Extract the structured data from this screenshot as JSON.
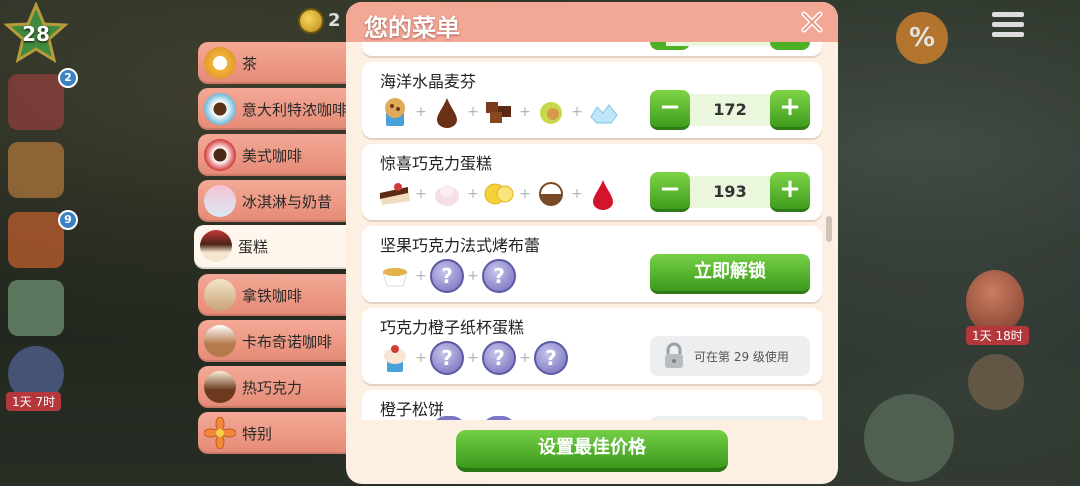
{
  "hud": {
    "level": "28",
    "coins_partial": "2",
    "notif_tasks": "2",
    "notif_gifts": "9",
    "timer_left": "1天 7时",
    "timer_right": "1天 18时",
    "discount_symbol": "%"
  },
  "tabs": [
    {
      "label": "茶",
      "icon": "tea-cup-icon"
    },
    {
      "label": "意大利特浓咖啡",
      "icon": "espresso-icon"
    },
    {
      "label": "美式咖啡",
      "icon": "americano-icon"
    },
    {
      "label": "冰淇淋与奶昔",
      "icon": "milkshake-icon"
    },
    {
      "label": "蛋糕",
      "icon": "cake-icon",
      "active": true
    },
    {
      "label": "拿铁咖啡",
      "icon": "latte-icon"
    },
    {
      "label": "卡布奇诺咖啡",
      "icon": "cappuccino-icon"
    },
    {
      "label": "热巧克力",
      "icon": "hot-chocolate-icon"
    },
    {
      "label": "特别",
      "icon": "special-flower-icon"
    }
  ],
  "panel": {
    "title": "您的菜单",
    "close_symbol": "✕"
  },
  "recipes": [
    {
      "name": "海洋水晶麦芬",
      "ingredients": [
        "muffin-icon",
        "chocolate-drop-icon",
        "chocolate-bar-icon",
        "hazelnut-icon",
        "sea-salt-crystal-icon"
      ],
      "price": "172",
      "state": "price"
    },
    {
      "name": "惊喜巧克力蛋糕",
      "ingredients": [
        "chocolate-cake-slice-icon",
        "cream-icon",
        "lemon-slice-icon",
        "coconut-icon",
        "red-drop-icon"
      ],
      "price": "193",
      "state": "price"
    },
    {
      "name": "坚果巧克力法式烤布蕾",
      "ingredients": [
        "creme-brulee-icon",
        "unknown-ingredient-icon",
        "unknown-ingredient-icon"
      ],
      "action_label": "立即解锁",
      "state": "unlock"
    },
    {
      "name": "巧克力橙子纸杯蛋糕",
      "ingredients": [
        "cupcake-icon",
        "unknown-ingredient-icon",
        "unknown-ingredient-icon",
        "unknown-ingredient-icon"
      ],
      "locked_text": "可在第 29 级使用",
      "state": "locked"
    },
    {
      "name": "橙子松饼",
      "state": "partial"
    }
  ],
  "footer": {
    "button_label": "设置最佳价格"
  },
  "colors": {
    "panel_bg": "#fdf0e3",
    "header_bg": "#f3a896",
    "tab_bg": "#ec9a85",
    "green_button": "#4caf26",
    "question_mark": "#7a76c4"
  }
}
